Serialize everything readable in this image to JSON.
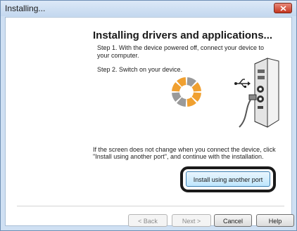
{
  "window": {
    "title": "Installing..."
  },
  "content": {
    "heading": "Installing drivers and applications...",
    "step1": "Step 1. With the device powered off, connect your device to your computer.",
    "step2": "Step 2. Switch on your device.",
    "info": "If the screen does not change when you connect the device, click \"Install using another port\", and continue with the installation."
  },
  "buttons": {
    "install_another_port": "Install using another port",
    "back": "< Back",
    "next": "Next >",
    "cancel": "Cancel",
    "help": "Help"
  },
  "icons": {
    "close": "close-icon",
    "spinner": "loading-spinner-icon",
    "computer": "computer-usb-illustration"
  },
  "colors": {
    "spinner_orange": "#f0a030",
    "spinner_gray": "#9a9a9a",
    "close_red": "#c5361f",
    "highlight": "#1a1a1a"
  }
}
